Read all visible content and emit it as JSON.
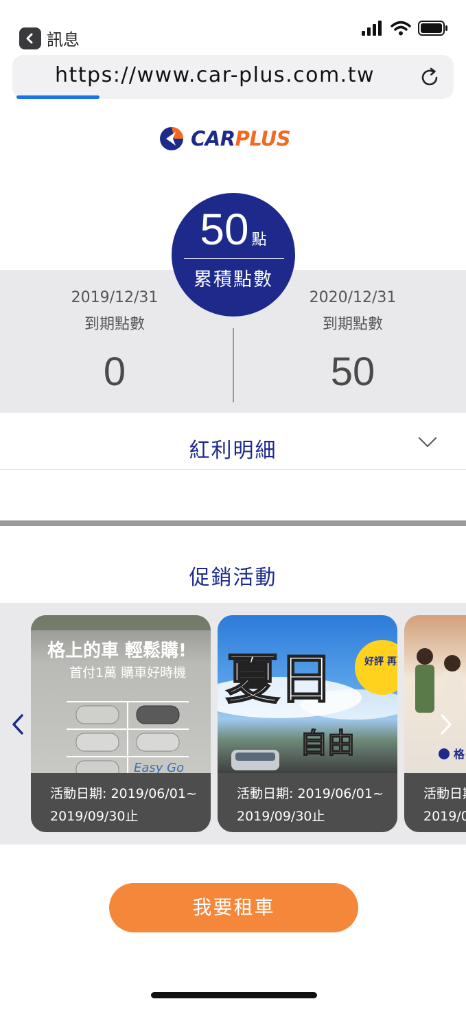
{
  "status_bar": {
    "back_label": "訊息"
  },
  "browser": {
    "url": "https://www.car-plus.com.tw"
  },
  "brand": {
    "logo_left": "CAR",
    "logo_right": "PLUS",
    "primary_color": "#1d2a8c",
    "accent_color": "#f26a21"
  },
  "points": {
    "total_value": "50",
    "total_unit": "點",
    "total_label": "累積點數",
    "expiry": [
      {
        "date": "2019/12/31",
        "label": "到期點數",
        "value": "0"
      },
      {
        "date": "2020/12/31",
        "label": "到期點數",
        "value": "50"
      }
    ]
  },
  "bonus_detail": {
    "title": "紅利明細"
  },
  "promotions": {
    "title": "促銷活動",
    "cards": [
      {
        "caption_line1": "活動日期: 2019/06/01~",
        "caption_line2": "2019/09/30止",
        "img_headline": "格上的車 輕鬆購!",
        "img_sub": "首付1萬 購車好時機",
        "img_corner": "Easy Go"
      },
      {
        "caption_line1": "活動日期: 2019/06/01~",
        "caption_line2": "2019/09/30止",
        "img_headline": "夏日",
        "img_sub": "自由",
        "img_badge": "好評 再延長"
      },
      {
        "caption_line1": "活動日期",
        "caption_line2": "2019/0",
        "img_logo": "格"
      }
    ]
  },
  "cta": {
    "label": "我要租車"
  }
}
